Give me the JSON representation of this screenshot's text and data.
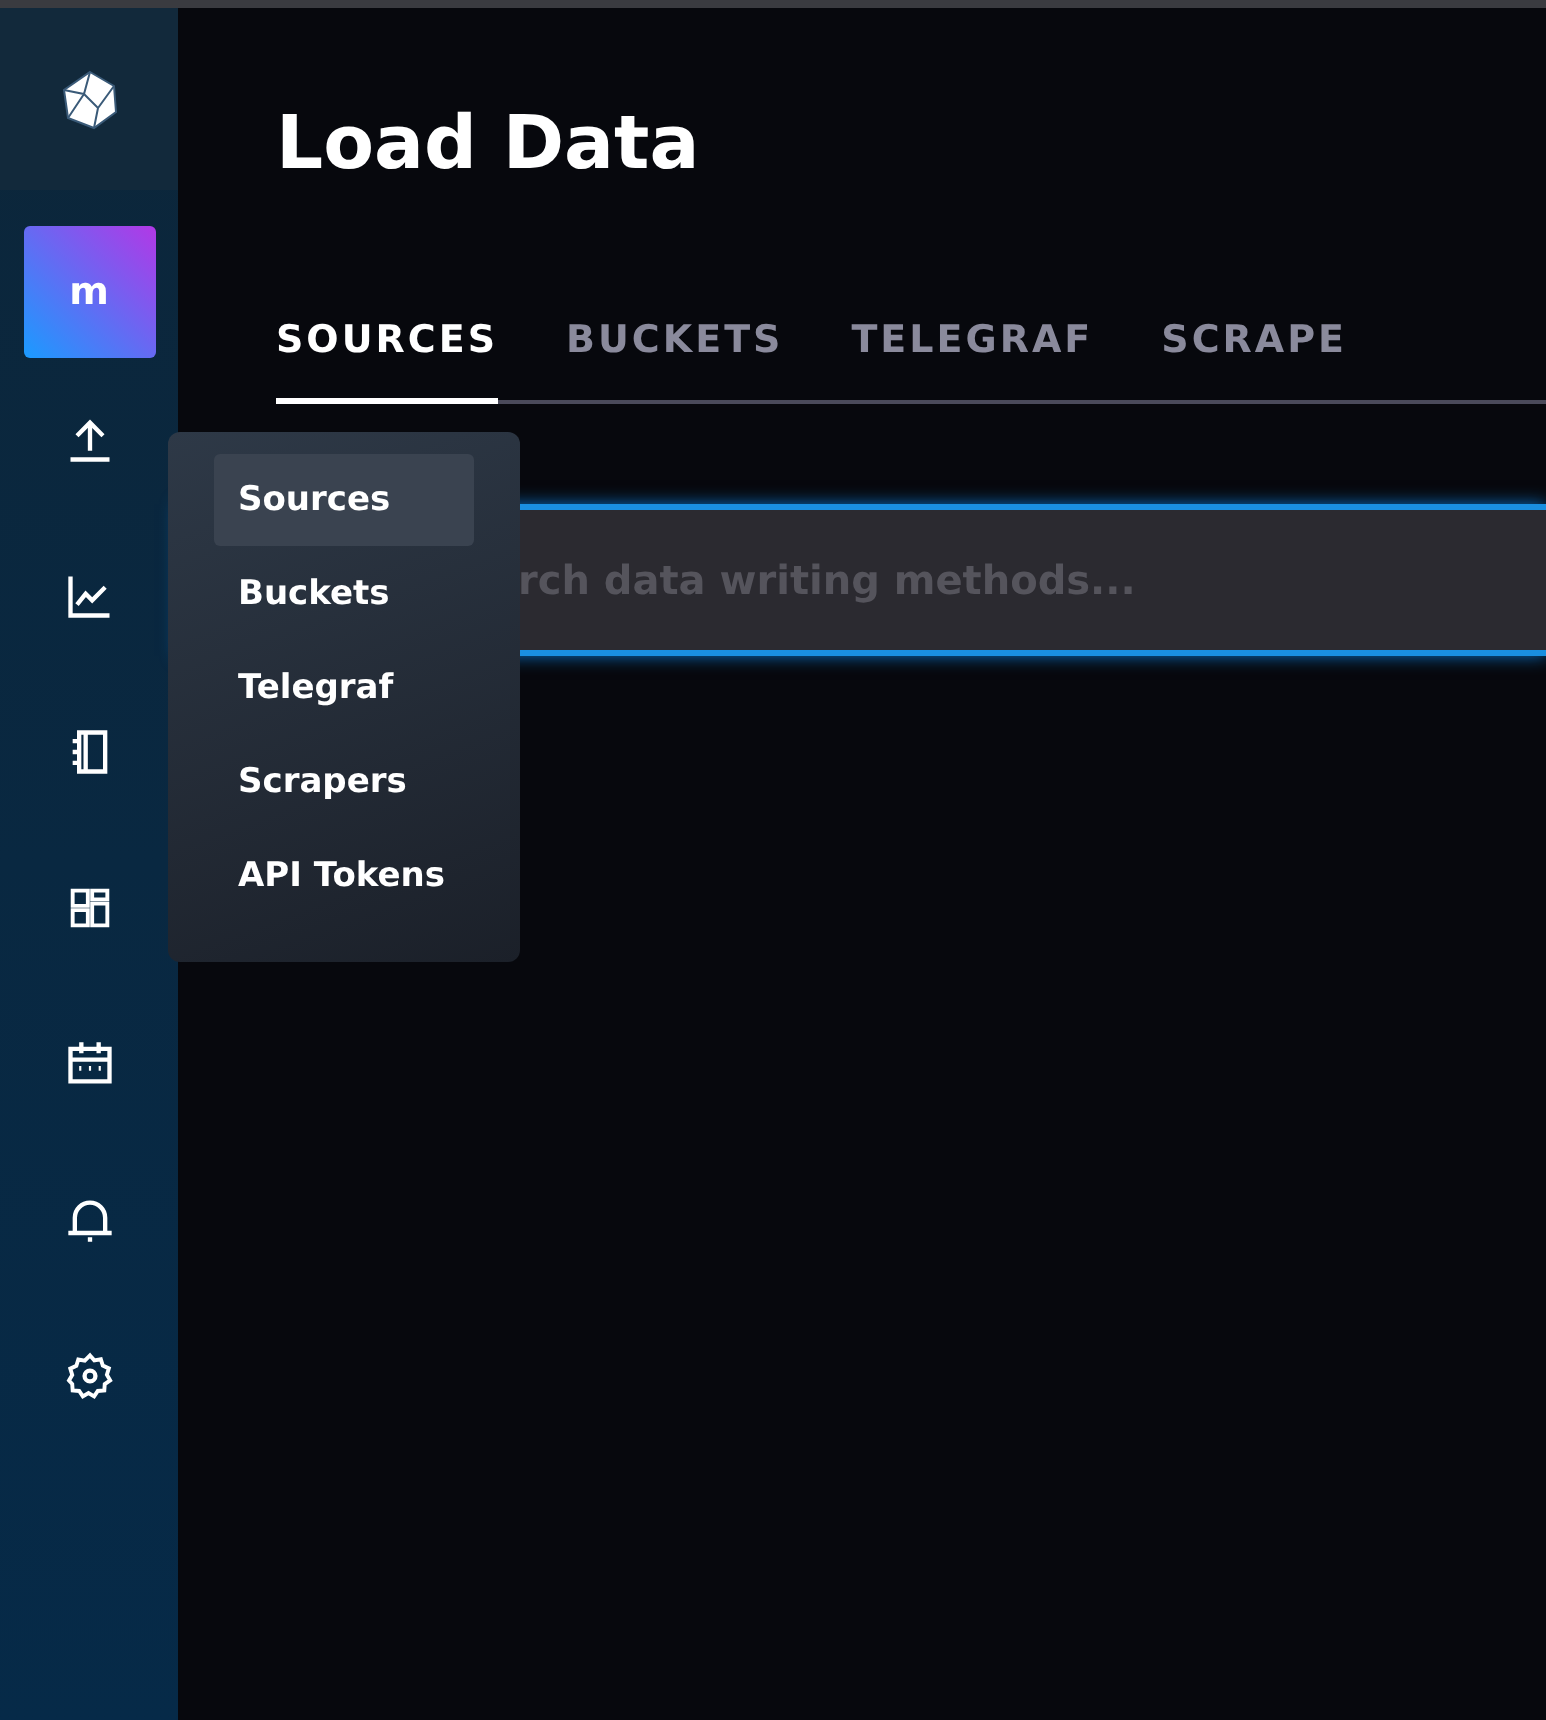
{
  "sidebar": {
    "avatar": "m",
    "items": [
      {
        "kind": "upload"
      },
      {
        "kind": "graph"
      },
      {
        "kind": "notebook"
      },
      {
        "kind": "dashboards"
      },
      {
        "kind": "calendar"
      },
      {
        "kind": "bell"
      },
      {
        "kind": "gear"
      }
    ]
  },
  "flyout_menu": {
    "items": [
      {
        "label": "Sources",
        "selected": true
      },
      {
        "label": "Buckets",
        "selected": false
      },
      {
        "label": "Telegraf",
        "selected": false
      },
      {
        "label": "Scrapers",
        "selected": false
      },
      {
        "label": "API Tokens",
        "selected": false
      }
    ]
  },
  "page": {
    "title": "Load Data",
    "tabs": [
      {
        "label": "SOURCES",
        "selected": true
      },
      {
        "label": "BUCKETS",
        "selected": false
      },
      {
        "label": "TELEGRAF",
        "selected": false
      },
      {
        "label": "SCRAPE",
        "selected": false
      }
    ],
    "search": {
      "placeholder": "rch data writing methods..."
    }
  }
}
